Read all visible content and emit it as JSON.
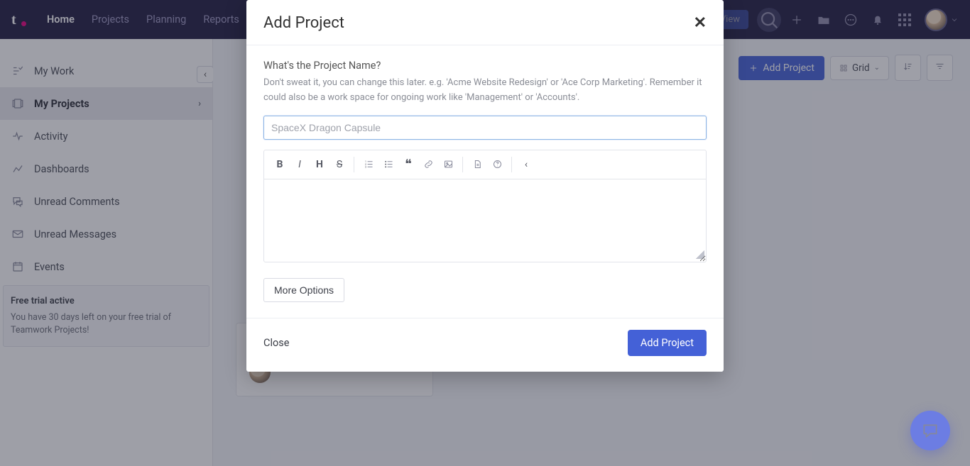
{
  "top": {
    "nav": [
      "Home",
      "Projects",
      "Planning",
      "Reports"
    ],
    "nav_active_index": 0,
    "rightbtn": "View"
  },
  "sidebar": {
    "items": [
      {
        "label": "My Work"
      },
      {
        "label": "My Projects"
      },
      {
        "label": "Activity"
      },
      {
        "label": "Dashboards"
      },
      {
        "label": "Unread Comments"
      },
      {
        "label": "Unread Messages"
      },
      {
        "label": "Events"
      }
    ],
    "trial_title": "Free trial active",
    "trial_text": "You have 30 days left on your free trial of Teamwork Projects!"
  },
  "page": {
    "add_project": "Add Project",
    "view_mode": "Grid"
  },
  "modal": {
    "title": "Add Project",
    "question": "What's the Project Name?",
    "hint": "Don't sweat it, you can change this later. e.g. 'Acme Website Redesign' or 'Ace Corp Marketing'. Remember it could also be a work space for ongoing work like 'Management' or 'Accounts'.",
    "name_placeholder": "SpaceX Dragon Capsule",
    "name_value": "",
    "more": "More Options",
    "close": "Close",
    "submit": "Add Project"
  }
}
